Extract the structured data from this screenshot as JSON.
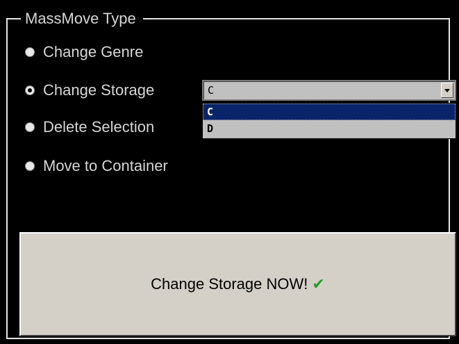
{
  "group": {
    "title": "MassMove Type"
  },
  "options": [
    {
      "label": "Change Genre",
      "checked": false
    },
    {
      "label": "Change Storage",
      "checked": true
    },
    {
      "label": "Delete Selection",
      "checked": false
    },
    {
      "label": "Move to Container",
      "checked": false
    }
  ],
  "storage_combo": {
    "value": "C",
    "items": [
      "C",
      "D"
    ],
    "highlighted": "C"
  },
  "action_button": {
    "label": "Change Storage NOW!",
    "icon": "checkmark-icon",
    "icon_glyph": "✔",
    "icon_color": "#2e9a2e"
  },
  "colors": {
    "background": "#000000",
    "selection": "#0a246a",
    "button_face": "#d4d0c8"
  }
}
